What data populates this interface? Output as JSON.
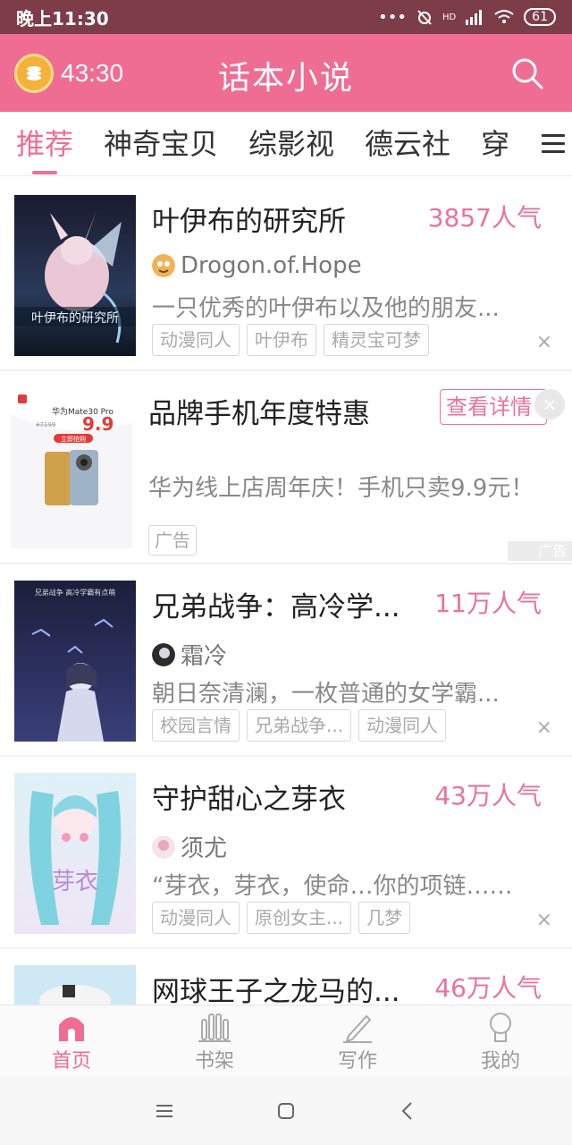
{
  "status_bar": {
    "time": "晚上11:30",
    "signal_text": "••• ",
    "hd": "HD",
    "battery": "61"
  },
  "header": {
    "timer": "43:30",
    "title": "话本小说",
    "accent": "#ef6d93"
  },
  "tabs": [
    {
      "label": "推荐",
      "active": true
    },
    {
      "label": "神奇宝贝",
      "active": false
    },
    {
      "label": "综影视",
      "active": false
    },
    {
      "label": "德云社",
      "active": false
    },
    {
      "label": "穿",
      "active": false
    }
  ],
  "feed": {
    "books": [
      {
        "title": "叶伊布的研究所",
        "popularity": "3857人气",
        "author": "Drogon.of.Hope",
        "description": "一只优秀的叶伊布以及他的朋友...",
        "tags": [
          "动漫同人",
          "叶伊布",
          "精灵宝可梦"
        ],
        "cover_text": "叶伊布的研究所"
      },
      {
        "title": "兄弟战争：高冷学...",
        "popularity": "11万人气",
        "author": "霜冷",
        "description": "朝日奈清澜，一枚普通的女学霸...",
        "tags": [
          "校园言情",
          "兄弟战争...",
          "动漫同人"
        ],
        "cover_text": "兄弟战争 高冷学霸有点萌"
      },
      {
        "title": "守护甜心之芽衣",
        "popularity": "43万人气",
        "author": "须尤",
        "description": "“芽衣，芽衣，使命…你的项链……",
        "tags": [
          "动漫同人",
          "原创女主...",
          "几梦"
        ],
        "cover_text": "芽衣"
      },
      {
        "title": "网球王子之龙马的...",
        "popularity": "46万人气",
        "author": "",
        "description": "",
        "tags": [],
        "cover_text": ""
      }
    ],
    "ad": {
      "title": "品牌手机年度特惠",
      "cta": "查看详情",
      "description": "华为线上店周年庆！手机只卖9.9元！",
      "tag": "广告",
      "corner_label": "广告",
      "image_brand": "华为Mate30 Pro",
      "image_price": "9.9",
      "image_old_price": "¥7199",
      "image_button": "立即抢购"
    }
  },
  "dismiss_symbol": "×",
  "bottom_nav": [
    {
      "label": "首页",
      "active": true
    },
    {
      "label": "书架",
      "active": false
    },
    {
      "label": "写作",
      "active": false
    },
    {
      "label": "我的",
      "active": false
    }
  ]
}
